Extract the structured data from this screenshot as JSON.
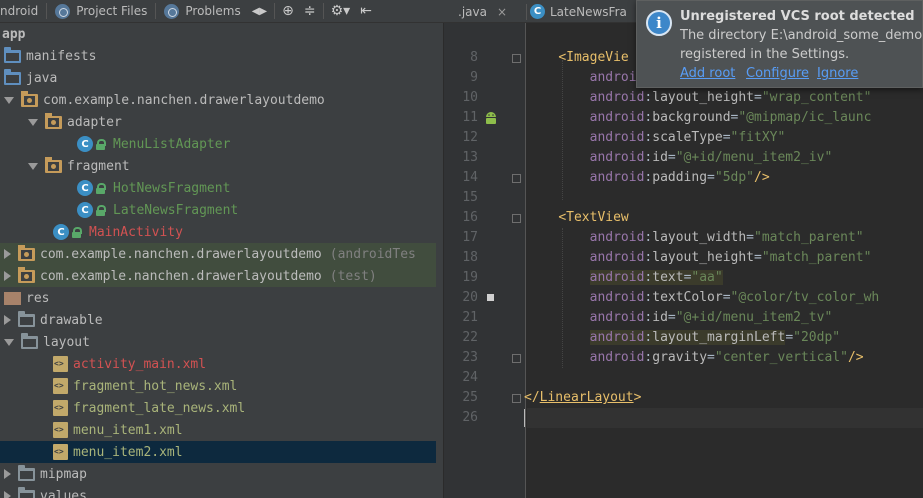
{
  "left_tabs": {
    "view_label": "ndroid",
    "project_files": "Project Files",
    "problems": "Problems"
  },
  "tree": {
    "root": "app",
    "items": [
      {
        "label": "manifests"
      },
      {
        "label": "java"
      },
      {
        "label": "com.example.nanchen.drawerlayoutdemo"
      },
      {
        "label": "adapter"
      },
      {
        "label": "MenuListAdapter"
      },
      {
        "label": "fragment"
      },
      {
        "label": "HotNewsFragment"
      },
      {
        "label": "LateNewsFragment"
      },
      {
        "label": "MainActivity"
      },
      {
        "label": "com.example.nanchen.drawerlayoutdemo",
        "suffix": "(androidTes"
      },
      {
        "label": "com.example.nanchen.drawerlayoutdemo",
        "suffix": "(test)"
      },
      {
        "label": "res"
      },
      {
        "label": "drawable"
      },
      {
        "label": "layout"
      },
      {
        "label": "activity_main.xml"
      },
      {
        "label": "fragment_hot_news.xml"
      },
      {
        "label": "fragment_late_news.xml"
      },
      {
        "label": "menu_item1.xml"
      },
      {
        "label": "menu_item2.xml"
      },
      {
        "label": "mipmap"
      },
      {
        "label": "values"
      }
    ]
  },
  "editor_tabs": {
    "tab1": ".java",
    "tab1_close": "×",
    "tab2": "LateNewsFra"
  },
  "editor": {
    "line_numbers": [
      "8",
      "9",
      "10",
      "11",
      "12",
      "13",
      "14",
      "15",
      "16",
      "17",
      "18",
      "19",
      "20",
      "21",
      "22",
      "23",
      "24",
      "25",
      "26"
    ],
    "lines": {
      "l8_tag": "ImageVie",
      "l9_ns": "androi",
      "l10": {
        "ns": "android",
        "attr": "layout_height",
        "val": "\"wrap_content\""
      },
      "l11": {
        "ns": "android",
        "attr": "background",
        "val": "\"@mipmap/ic_launc"
      },
      "l12": {
        "ns": "android",
        "attr": "scaleType",
        "val": "\"fitXY\""
      },
      "l13": {
        "ns": "android",
        "attr": "id",
        "val": "\"@+id/menu_item2_iv\""
      },
      "l14": {
        "ns": "android",
        "attr": "padding",
        "val": "\"5dp\"",
        "end": "/>"
      },
      "l16_tag": "TextView",
      "l17": {
        "ns": "android",
        "attr": "layout_width",
        "val": "\"match_parent\""
      },
      "l18": {
        "ns": "android",
        "attr": "layout_height",
        "val": "\"match_parent\""
      },
      "l19": {
        "ns": "android",
        "attr": "text",
        "val": "\"aa\""
      },
      "l20": {
        "ns": "android",
        "attr": "textColor",
        "val": "\"@color/tv_color_wh"
      },
      "l21": {
        "ns": "android",
        "attr": "id",
        "val": "\"@+id/menu_item2_tv\""
      },
      "l22": {
        "ns": "android",
        "attr": "layout_marginLeft",
        "val": "\"20dp\""
      },
      "l23": {
        "ns": "android",
        "attr": "gravity",
        "val": "\"center_vertical\"",
        "end": "/>"
      },
      "l25_tag": "LinearLayout"
    }
  },
  "vcs_popup": {
    "title": "Unregistered VCS root detected",
    "message_line1": "The directory E:\\android_some_demo",
    "message_line2": "registered in the Settings.",
    "add_root": "Add root",
    "configure": "Configure",
    "ignore": "Ignore"
  },
  "colors": {
    "tag": "#e8bf6a",
    "namespace": "#9876aa",
    "attribute": "#bababa",
    "value": "#6a8759",
    "link": "#589df6"
  }
}
